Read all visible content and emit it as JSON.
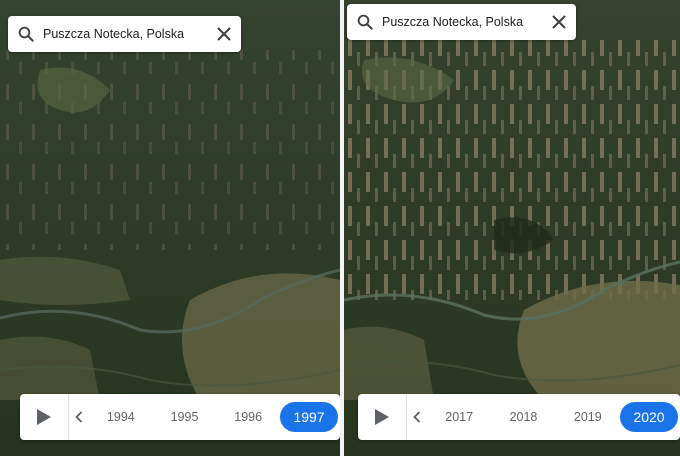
{
  "panels": [
    {
      "search": {
        "query": "Puszcza Notecka, Polska",
        "search_icon": "search-icon",
        "close_icon": "close-icon"
      },
      "timeline": {
        "years": [
          "1994",
          "1995",
          "1996"
        ],
        "selected": "1997",
        "play_icon": "play-icon",
        "prev_icon": "chevron-left-icon"
      }
    },
    {
      "search": {
        "query": "Puszcza Notecka, Polska",
        "search_icon": "search-icon",
        "close_icon": "close-icon"
      },
      "timeline": {
        "years": [
          "2017",
          "2018",
          "2019"
        ],
        "selected": "2020",
        "play_icon": "play-icon",
        "prev_icon": "chevron-left-icon"
      }
    }
  ],
  "colors": {
    "accent": "#1a73e8",
    "forest": "#2b3a28",
    "farmland": "#6a6a48",
    "clearcut": "#8a7a62",
    "river": "#5b6e5a"
  }
}
